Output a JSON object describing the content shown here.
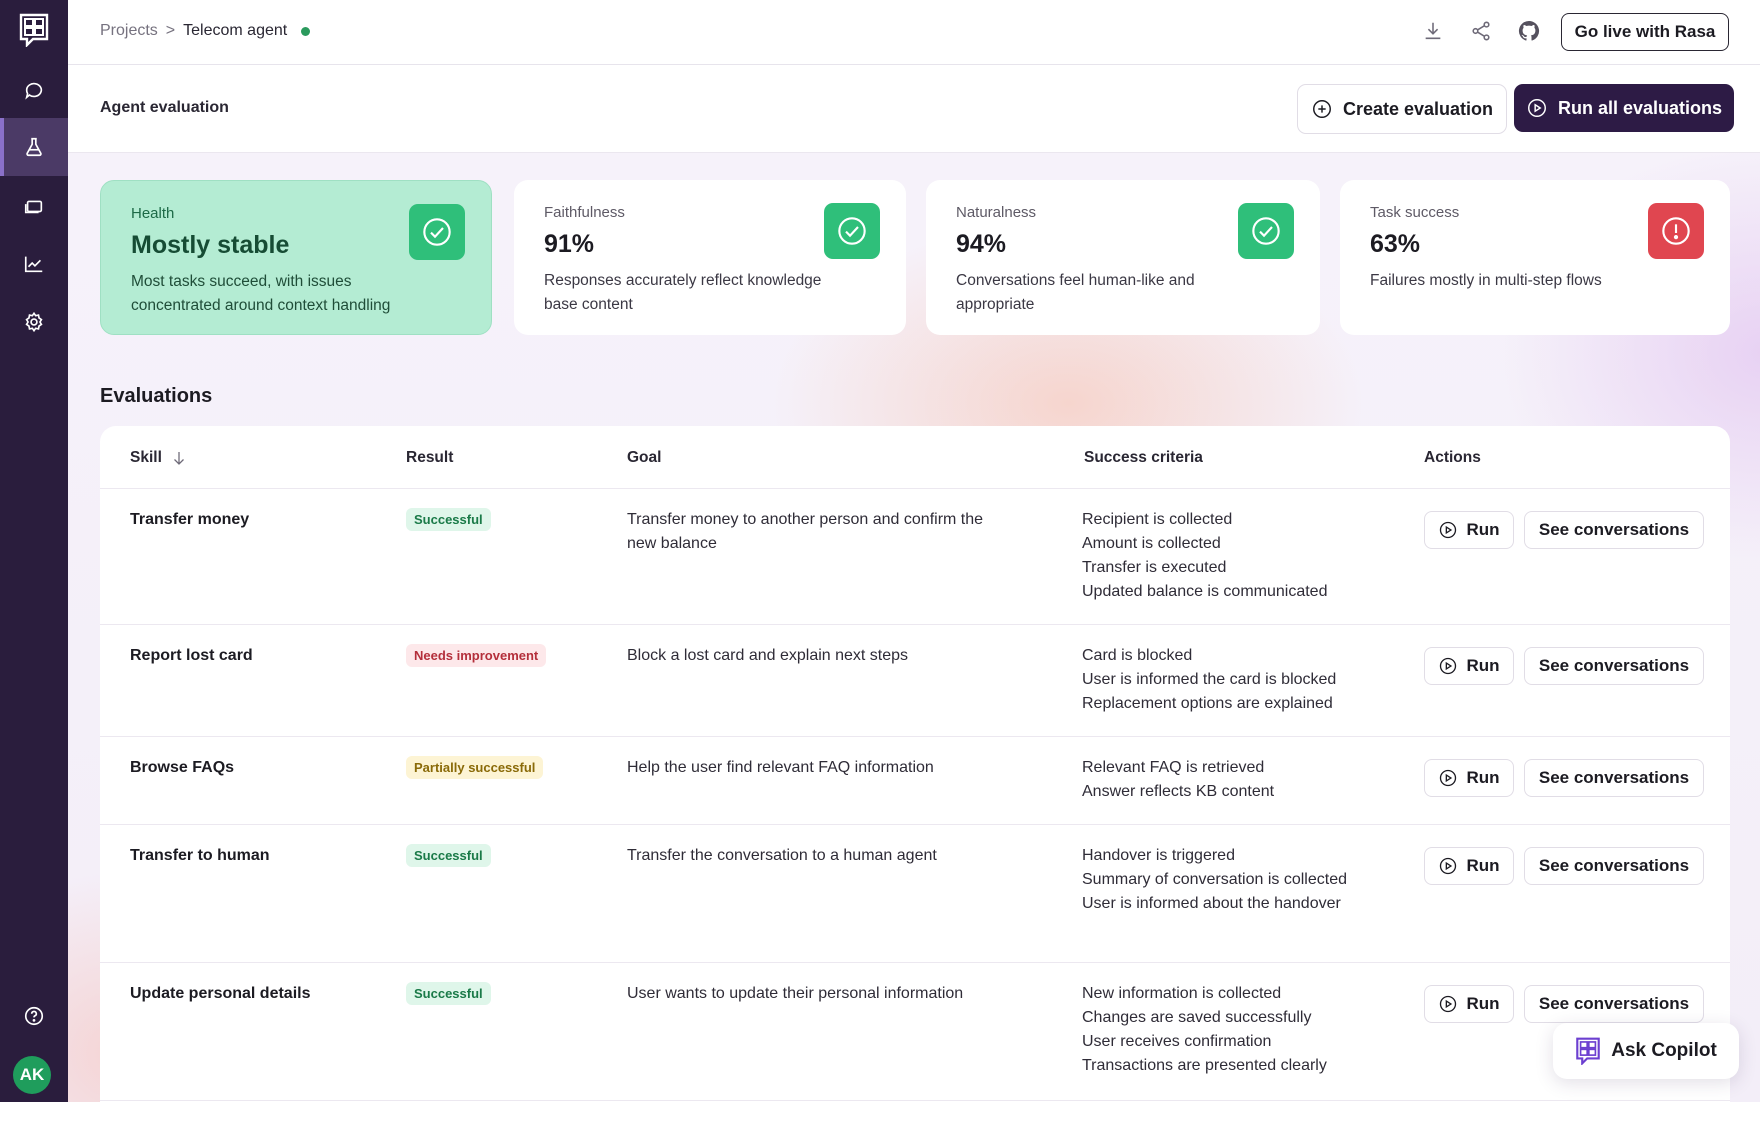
{
  "breadcrumb": {
    "root": "Projects",
    "separator": ">",
    "current": "Telecom agent"
  },
  "topbar": {
    "go_live_label": "Go live with Rasa",
    "icons": [
      "download-icon",
      "share-icon",
      "github-icon"
    ]
  },
  "header": {
    "title": "Agent evaluation",
    "create_label": "Create evaluation",
    "run_all_label": "Run all evaluations"
  },
  "sidebar": {
    "items": [
      "chat-icon",
      "flask-icon",
      "folder-icon",
      "analytics-icon",
      "gear-icon"
    ],
    "active": "flask-icon",
    "avatar_initials": "AK"
  },
  "metrics": [
    {
      "label": "Health",
      "value": "Mostly stable",
      "desc": "Most tasks succeed, with issues concentrated around context handling",
      "status": "ok"
    },
    {
      "label": "Faithfulness",
      "value": "91%",
      "desc": "Responses accurately reflect knowledge base content",
      "status": "ok"
    },
    {
      "label": "Naturalness",
      "value": "94%",
      "desc": "Conversations feel human-like and appropriate",
      "status": "ok"
    },
    {
      "label": "Task success",
      "value": "63%",
      "desc": "Failures mostly in multi-step flows",
      "status": "bad"
    }
  ],
  "evaluations": {
    "title": "Evaluations",
    "columns": {
      "skill": "Skill",
      "result": "Result",
      "goal": "Goal",
      "criteria": "Success criteria",
      "actions": "Actions"
    },
    "run_label": "Run",
    "see_label": "See conversations",
    "rows": [
      {
        "skill": "Transfer money",
        "result": "Successful",
        "result_type": "success",
        "goal": "Transfer money to another person and confirm the new balance",
        "criteria": [
          "Recipient is collected",
          "Amount is collected",
          "Transfer is executed",
          "Updated balance is communicated"
        ]
      },
      {
        "skill": "Report lost card",
        "result": "Needs improvement",
        "result_type": "warn",
        "goal": "Block a lost card and explain next steps",
        "criteria": [
          "Card is blocked",
          "User is informed the card is blocked",
          "Replacement options are explained"
        ]
      },
      {
        "skill": "Browse FAQs",
        "result": "Partially successful",
        "result_type": "partial",
        "goal": "Help the user find relevant FAQ information",
        "criteria": [
          "Relevant FAQ is retrieved",
          "Answer reflects KB content"
        ]
      },
      {
        "skill": "Transfer to human",
        "result": "Successful",
        "result_type": "success",
        "goal": "Transfer the conversation to a human agent",
        "criteria": [
          "Handover is triggered",
          "Summary of conversation is collected",
          "User is informed about the handover"
        ]
      },
      {
        "skill": "Update personal details",
        "result": "Successful",
        "result_type": "success",
        "goal": "User wants to update their personal information",
        "criteria": [
          "New information is collected",
          "Changes are saved successfully",
          "User receives confirmation",
          "Transactions are presented clearly"
        ]
      }
    ]
  },
  "copilot": {
    "label": "Ask Copilot"
  }
}
